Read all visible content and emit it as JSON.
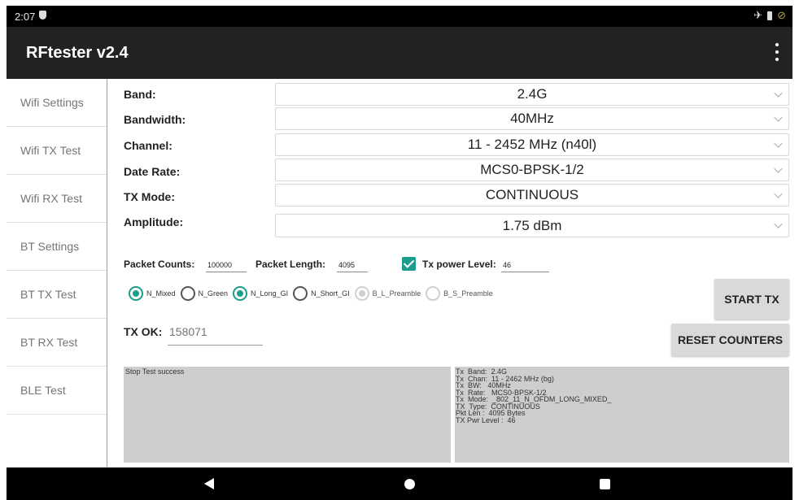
{
  "status_bar": {
    "time": "2:07",
    "shield_icon": "shield-icon",
    "airplane_icon": "airplane-icon",
    "battery_icon": "battery-icon",
    "no_signal_icon": "no-signal-icon"
  },
  "app_bar": {
    "title": "RFtester v2.4",
    "overflow_icon": "more-vert-icon"
  },
  "sidebar": {
    "items": [
      {
        "label": "Wifi Settings"
      },
      {
        "label": "Wifi TX Test"
      },
      {
        "label": "Wifi RX Test"
      },
      {
        "label": "BT Settings"
      },
      {
        "label": "BT TX Test"
      },
      {
        "label": "BT RX Test"
      },
      {
        "label": "BLE Test"
      }
    ]
  },
  "settings": {
    "band": {
      "label": "Band:",
      "value": "2.4G"
    },
    "bandwidth": {
      "label": "Bandwidth:",
      "value": "40MHz"
    },
    "channel": {
      "label": "Channel:",
      "value": "11 - 2452 MHz (n40l)"
    },
    "date_rate": {
      "label": "Date Rate:",
      "value": "MCS0-BPSK-1/2"
    },
    "tx_mode": {
      "label": "TX Mode:",
      "value": "CONTINUOUS"
    },
    "amplitude": {
      "label": "Amplitude:",
      "value": "1.75 dBm"
    }
  },
  "packet": {
    "counts_label": "Packet Counts:",
    "counts_value": "100000",
    "length_label": "Packet Length:",
    "length_value": "4095",
    "tx_power_checked": true,
    "tx_power_label": "Tx power Level:",
    "tx_power_value": "46"
  },
  "radios": [
    {
      "label": "N_Mixed",
      "checked": true,
      "enabled": true
    },
    {
      "label": "N_Green",
      "checked": false,
      "enabled": true
    },
    {
      "label": "N_Long_GI",
      "checked": true,
      "enabled": true
    },
    {
      "label": "N_Short_GI",
      "checked": false,
      "enabled": true
    },
    {
      "label": "B_L_Preamble",
      "checked": true,
      "enabled": false
    },
    {
      "label": "B_S_Preamble",
      "checked": false,
      "enabled": false
    }
  ],
  "buttons": {
    "start_tx": "START TX",
    "reset_counters": "RESET COUNTERS"
  },
  "tx_ok": {
    "label": "TX OK:",
    "value": "158071"
  },
  "log_left": {
    "text": "Stop Test success"
  },
  "log_right": {
    "lines": [
      "Tx  Band:  2.4G",
      "Tx  Chan:  11 - 2462 MHz (bg)",
      "Tx  BW:   40MHz",
      "Tx  Rate:   MCS0-BPSK-1/2",
      "Tx  Mode:  _802_11_N_OFDM_LONG_MIXED_",
      "TX  Type:  CONTINUOUS",
      "Pkt Len :  4095 Bytes",
      "TX Pwr Level :  46"
    ]
  },
  "colors": {
    "accent": "#1c9d8c",
    "app_bar": "#222222",
    "log_bg": "#cecece",
    "button_bg": "#d9d9d9"
  },
  "nav_bar": {
    "back_icon": "back-triangle-icon",
    "home_icon": "home-circle-icon",
    "recents_icon": "recents-square-icon"
  }
}
